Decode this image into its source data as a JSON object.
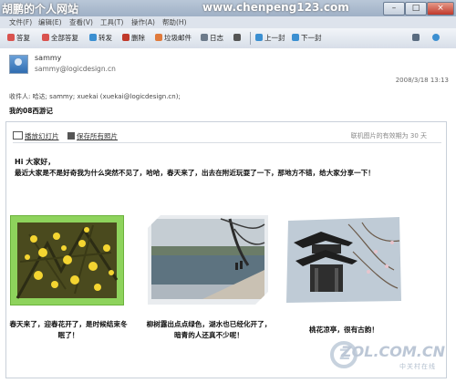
{
  "window": {
    "title_left": "胡鹏的个人网站",
    "title_right": "www.chenpeng123.com",
    "controls": [
      "–",
      "□",
      "×"
    ]
  },
  "menu": [
    "文件(F)",
    "编辑(E)",
    "查看(V)",
    "工具(T)",
    "操作(A)",
    "帮助(H)"
  ],
  "toolbar": {
    "reply": "答复",
    "reply_all": "全部答复",
    "forward": "转发",
    "delete": "删除",
    "junk": "垃圾邮件",
    "calendar": "日志",
    "prev": "上一封",
    "next": "下一封"
  },
  "message": {
    "sender": "sammy",
    "sender_email": "sammy@logicdesign.cn",
    "date": "2008/3/18 13:13",
    "recipients": "收件人: 哈达; sammy; xuekai (xuekai@logicdesign.cn);",
    "subject": "我的08西游记"
  },
  "slideshow": {
    "play_label": "播放幻灯片",
    "save_label": "保存所有照片",
    "validity": "联机图片的有效期为 30 天"
  },
  "body": {
    "greeting": "Hi 大家好，",
    "paragraph": "最近大家是不是好奇我为什么突然不见了，哈哈，春天来了，出去在附近玩耍了一下，那地方不错，给大家分享一下！"
  },
  "photos": [
    {
      "name": "flowers",
      "caption": "春天来了，迎春花开了，是时候结束冬眠了！"
    },
    {
      "name": "lake",
      "caption": "柳树露出点点绿色，湖水也已经化开了，暗青的人还真不少呢！"
    },
    {
      "name": "pavilion",
      "caption": "桃花凉亭，很有古韵！"
    }
  ],
  "watermark": {
    "logo": "ZOL.COM.CN",
    "sub": "中关村在线"
  },
  "colors": {
    "accent": "#2f6cb0",
    "frame_green": "#8ed35c"
  }
}
